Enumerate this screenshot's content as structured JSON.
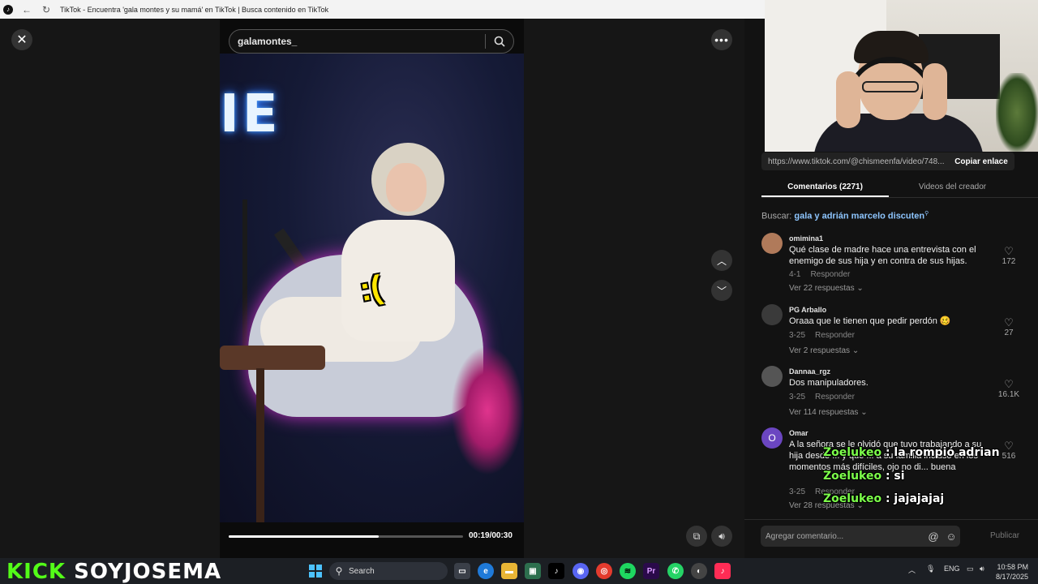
{
  "browser": {
    "title": "TikTok - Encuentra 'gala montes y su mamá' en TikTok | Busca contenido en TikTok"
  },
  "viewer": {
    "search_value": "galamontes_",
    "sticker": ":(",
    "time": "00:19/00:30",
    "progress_fraction": 0.64
  },
  "panel": {
    "link_url": "https://www.tiktok.com/@chismeenfa/video/748...",
    "copy_link": "Copiar enlace",
    "tabs": [
      {
        "label": "Comentarios (2271)"
      },
      {
        "label": "Videos del creador"
      }
    ],
    "search_prefix": "Buscar:",
    "search_term": "gala y adrián marcelo discuten",
    "comments": [
      {
        "user": "omimina1",
        "text": "Qué clase de madre hace una entrevista con el enemigo de sus hija y en contra de sus hijas.",
        "date": "4-1",
        "reply": "Responder",
        "replies": "Ver 22 respuestas",
        "likes": "172"
      },
      {
        "user": "PG Arballo",
        "text": "Oraaa que le tienen que pedir perdón 🥴",
        "date": "3-25",
        "reply": "Responder",
        "replies": "Ver 2 respuestas",
        "likes": "27"
      },
      {
        "user": "Dannaa_rgz",
        "text": "Dos manipuladores.",
        "date": "3-25",
        "reply": "Responder",
        "replies": "Ver 114 respuestas",
        "likes": "16.1K"
      },
      {
        "user": "Omar",
        "initial": "O",
        "text": "A la señora se le olvidó que tuvo trabajando a su hija desde ... y que ... a su familia incluso en los momentos más difíciles, ojo no di... buena",
        "date": "3-25",
        "reply": "Responder",
        "replies": "Ver 28 respuestas",
        "likes": "516"
      }
    ],
    "add_comment_placeholder": "Agregar comentario...",
    "publish": "Publicar"
  },
  "chat": [
    {
      "user": "Zoelukeo",
      "msg": ": la rompió adrian"
    },
    {
      "user": "Zoelukeo",
      "msg": ": si"
    },
    {
      "user": "Zoelukeo",
      "msg": ": jajajajaj"
    }
  ],
  "taskbar": {
    "brand_kick": "KICK",
    "brand_name": "SOYJOSEMA",
    "search_label": "Search",
    "lang": "ENG",
    "time": "10:58 PM",
    "date": "8/17/2025"
  },
  "colors": {
    "kick_green": "#53fc18",
    "chat_user": "#7cff4a",
    "link_blue": "#8ec6ff",
    "sticker": "#ffe600"
  }
}
